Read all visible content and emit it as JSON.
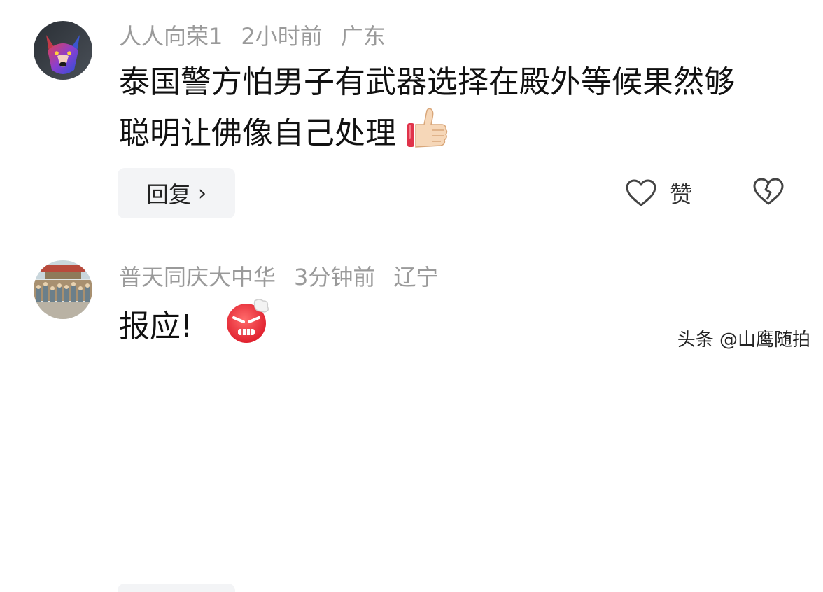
{
  "comments": [
    {
      "username": "人人向荣1",
      "time": "2小时前",
      "location": "广东",
      "text_line1": "泰国警方怕男子有武器选择在殿外等候果然够",
      "text_line2": "聪明让佛像自己处理",
      "emoji": "thumbs-up",
      "reply_label": "回复",
      "reply_chevron": "›",
      "like_label": "赞"
    },
    {
      "username": "普天同庆大中华",
      "time": "3分钟前",
      "location": "辽宁",
      "text_line1": "报应!",
      "emoji": "angry-face"
    }
  ],
  "watermark": "头条 @山鹰随拍",
  "colors": {
    "meta": "#9a9a9a",
    "text": "#111111",
    "reply_bg": "#f3f4f6"
  }
}
